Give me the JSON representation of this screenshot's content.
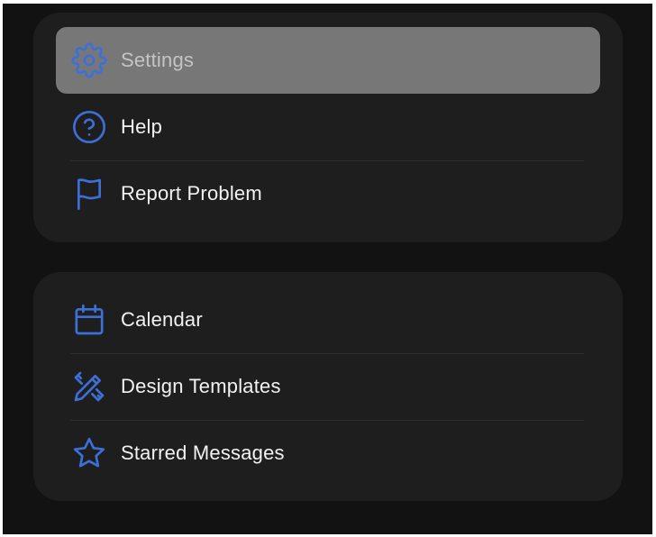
{
  "menu": {
    "group1": [
      {
        "label": "Settings",
        "icon": "gear-icon",
        "selected": true
      },
      {
        "label": "Help",
        "icon": "question-circle-icon",
        "selected": false
      },
      {
        "label": "Report Problem",
        "icon": "flag-icon",
        "selected": false
      }
    ],
    "group2": [
      {
        "label": "Calendar",
        "icon": "calendar-icon",
        "selected": false
      },
      {
        "label": "Design Templates",
        "icon": "pencil-ruler-icon",
        "selected": false
      },
      {
        "label": "Starred Messages",
        "icon": "star-icon",
        "selected": false
      }
    ]
  },
  "colors": {
    "background": "#121212",
    "card": "#1e1e1e",
    "selected_row": "#777777",
    "icon_accent": "#3d6fd9",
    "text": "#f2f2f2",
    "divider": "#2e2e2e"
  }
}
